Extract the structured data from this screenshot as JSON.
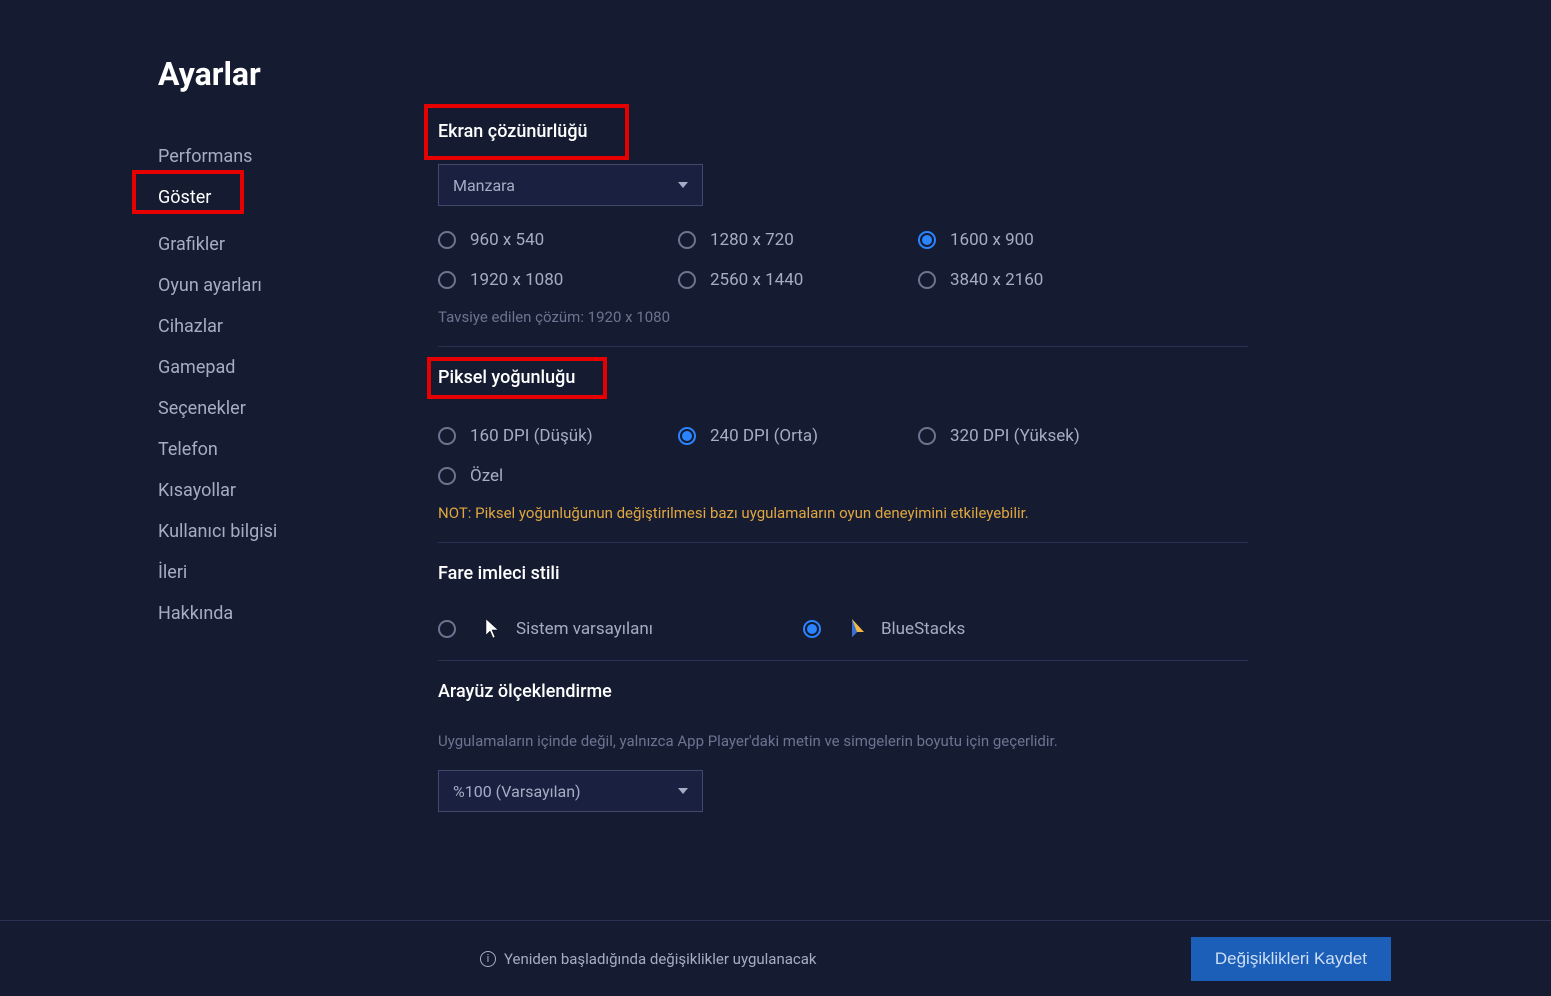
{
  "title": "Ayarlar",
  "sidebar": {
    "items": [
      {
        "label": "Performans",
        "active": false
      },
      {
        "label": "Göster",
        "active": true
      },
      {
        "label": "Grafikler",
        "active": false
      },
      {
        "label": "Oyun ayarları",
        "active": false
      },
      {
        "label": "Cihazlar",
        "active": false
      },
      {
        "label": "Gamepad",
        "active": false
      },
      {
        "label": "Seçenekler",
        "active": false
      },
      {
        "label": "Telefon",
        "active": false
      },
      {
        "label": "Kısayollar",
        "active": false
      },
      {
        "label": "Kullanıcı bilgisi",
        "active": false
      },
      {
        "label": "İleri",
        "active": false
      },
      {
        "label": "Hakkında",
        "active": false
      }
    ]
  },
  "resolution": {
    "title": "Ekran çözünürlüğü",
    "orientation": "Manzara",
    "options": [
      {
        "label": "960 x 540",
        "selected": false
      },
      {
        "label": "1280 x 720",
        "selected": false
      },
      {
        "label": "1600 x 900",
        "selected": true
      },
      {
        "label": "1920 x 1080",
        "selected": false
      },
      {
        "label": "2560 x 1440",
        "selected": false
      },
      {
        "label": "3840 x 2160",
        "selected": false
      }
    ],
    "hint": "Tavsiye edilen çözüm: 1920 x 1080"
  },
  "dpi": {
    "title": "Piksel yoğunluğu",
    "options": [
      {
        "label": "160 DPI (Düşük)",
        "selected": false
      },
      {
        "label": "240 DPI (Orta)",
        "selected": true
      },
      {
        "label": "320 DPI (Yüksek)",
        "selected": false
      },
      {
        "label": "Özel",
        "selected": false
      }
    ],
    "warning": "NOT: Piksel yoğunluğunun değiştirilmesi bazı uygulamaların oyun deneyimini etkileyebilir."
  },
  "cursor": {
    "title": "Fare imleci stili",
    "options": [
      {
        "label": "Sistem varsayılanı",
        "selected": false,
        "icon": "system"
      },
      {
        "label": "BlueStacks",
        "selected": true,
        "icon": "bluestacks"
      }
    ]
  },
  "scaling": {
    "title": "Arayüz ölçeklendirme",
    "description": "Uygulamaların içinde değil, yalnızca App Player'daki metin ve simgelerin boyutu için geçerlidir.",
    "value": "%100 (Varsayılan)"
  },
  "footer": {
    "info": "Yeniden başladığında değişiklikler uygulanacak",
    "save": "Değişiklikleri Kaydet"
  }
}
